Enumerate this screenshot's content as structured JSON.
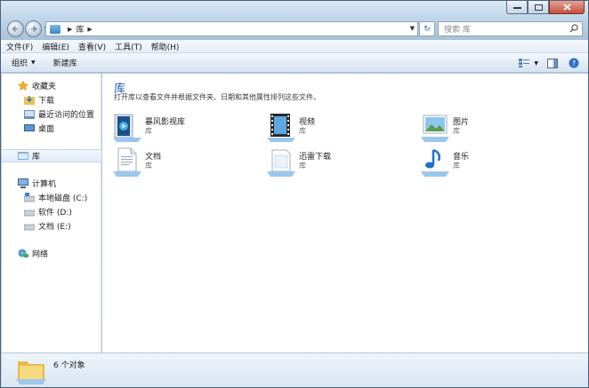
{
  "address": {
    "segments": [
      "库"
    ],
    "placeholder": "搜索 库"
  },
  "menu": [
    "文件(F)",
    "编辑(E)",
    "查看(V)",
    "工具(T)",
    "帮助(H)"
  ],
  "toolbar": {
    "organize": "组织",
    "new_library": "新建库"
  },
  "nav": {
    "favorites": "收藏夹",
    "downloads": "下载",
    "recent": "最近访问的位置",
    "desktop": "桌面",
    "libraries": "库",
    "computer": "计算机",
    "drive_c": "本地磁盘 (C:)",
    "drive_d": "软件 (D:)",
    "drive_e": "文档 (E:)",
    "network": "网络"
  },
  "content": {
    "title": "库",
    "description": "打开库以查看文件并根据文件夹、日期和其他属性排列这些文件。",
    "items": [
      {
        "name": "暴风影视库",
        "type": "库",
        "icon": "video-library-icon"
      },
      {
        "name": "视频",
        "type": "库",
        "icon": "film-icon"
      },
      {
        "name": "图片",
        "type": "库",
        "icon": "picture-icon"
      },
      {
        "name": "文档",
        "type": "库",
        "icon": "document-icon"
      },
      {
        "name": "迅雷下载",
        "type": "库",
        "icon": "download-library-icon"
      },
      {
        "name": "音乐",
        "type": "库",
        "icon": "music-icon"
      }
    ]
  },
  "status": {
    "count": "6 个对象"
  },
  "colors": {
    "title_blue": "#1e5fa8",
    "selection": "#dfeaf6"
  }
}
